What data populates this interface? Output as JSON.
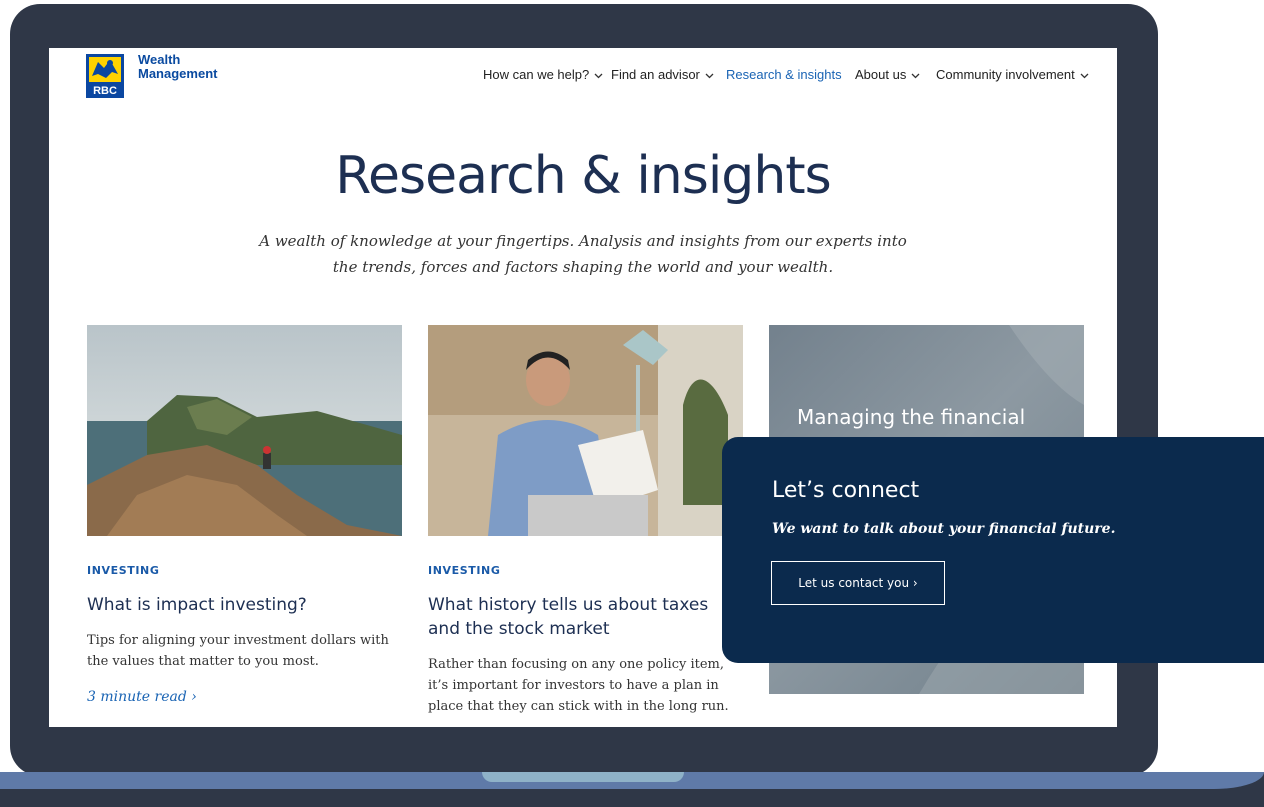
{
  "brand": {
    "line1": "Wealth",
    "line2": "Management",
    "logo_text": "RBC"
  },
  "nav": [
    {
      "label": "How can we help?",
      "dropdown": true,
      "active": false
    },
    {
      "label": "Find an advisor",
      "dropdown": true,
      "active": false
    },
    {
      "label": "Research & insights",
      "dropdown": false,
      "active": true
    },
    {
      "label": "About us",
      "dropdown": true,
      "active": false
    },
    {
      "label": "Community involvement",
      "dropdown": true,
      "active": false
    }
  ],
  "hero": {
    "title": "Research & insights",
    "subtitle": "A wealth of knowledge at your fingertips. Analysis and insights from our experts into the trends, forces and factors shaping the world and your wealth."
  },
  "cards": [
    {
      "category": "INVESTING",
      "title": "What is impact investing?",
      "description": "Tips for aligning your investment dollars with the values that matter to you most.",
      "read_time": "3 minute read ›"
    },
    {
      "category": "INVESTING",
      "title": "What history tells us about taxes and the stock market",
      "description": "Rather than focusing on any one policy item, it’s important for investors to have a plan in place that they can stick with in the long run."
    }
  ],
  "feature": {
    "title": "Managing the financial"
  },
  "connect": {
    "title": "Let’s connect",
    "subtitle": "We want to talk about your financial future.",
    "button_label": "Let us contact you ›"
  },
  "colors": {
    "frame": "#2f3747",
    "navy": "#0b2a4d",
    "accent_blue": "#1a64b4",
    "heading": "#1d2f52"
  }
}
